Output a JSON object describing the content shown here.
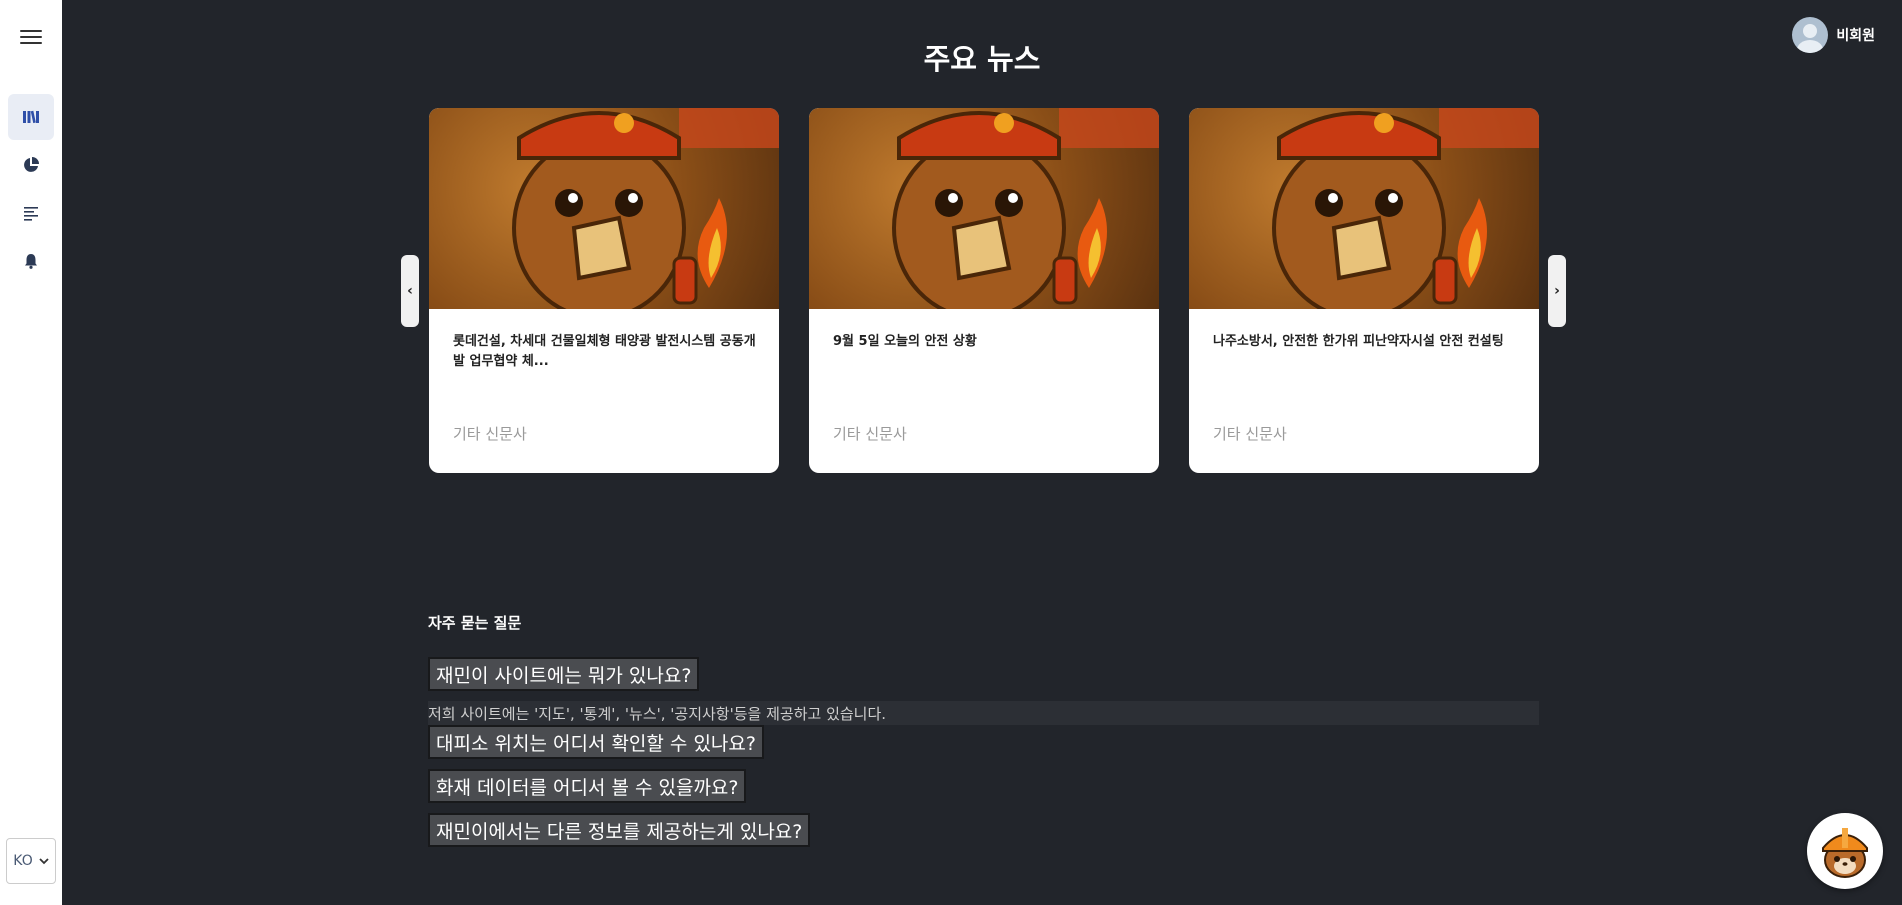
{
  "sidebar": {
    "items": [
      {
        "icon": "library-icon",
        "active": true
      },
      {
        "icon": "pie-chart-icon",
        "active": false
      },
      {
        "icon": "text-lines-icon",
        "active": false
      },
      {
        "icon": "bell-icon",
        "active": false
      }
    ],
    "language": "KO"
  },
  "header": {
    "title": "주요 뉴스",
    "user_name": "비회원"
  },
  "news": {
    "cards": [
      {
        "title": "롯데건설, 차세대 건물일체형 태양광 발전시스템 공동개발 업무협약 체...",
        "source": "기타 신문사"
      },
      {
        "title": "9월 5일 오늘의 안전 상황",
        "source": "기타 신문사"
      },
      {
        "title": "나주소방서, 안전한 한가위 피난약자시설 안전 컨설팅",
        "source": "기타 신문사"
      }
    ],
    "prev_label": "‹",
    "next_label": "›"
  },
  "faq": {
    "title": "자주 묻는 질문",
    "items": [
      {
        "question": "재민이 사이트에는 뭐가 있나요?",
        "answer": "저희 사이트에는 '지도', '통계', '뉴스', '공지사항'등을 제공하고 있습니다."
      },
      {
        "question": "대피소 위치는 어디서 확인할 수 있나요?"
      },
      {
        "question": "화재 데이터를 어디서 볼 수 있을까요?"
      },
      {
        "question": "재민이에서는 다른 정보를 제공하는게 있나요?"
      }
    ]
  },
  "colors": {
    "background": "#22252b",
    "sidebar": "#ffffff",
    "accent": "#2f4fa8",
    "faq_button": "#4a4c50"
  }
}
